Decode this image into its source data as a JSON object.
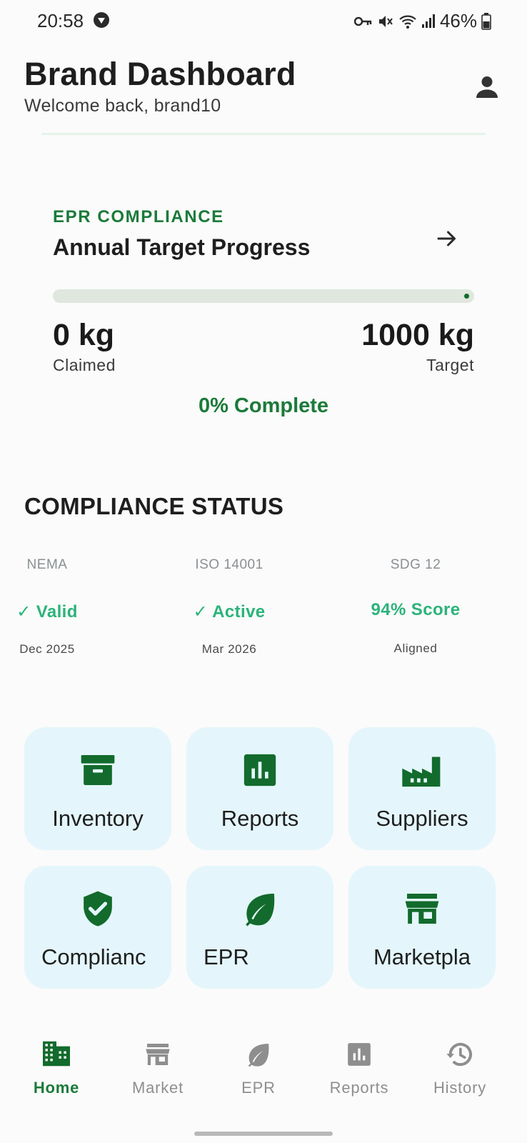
{
  "status_bar": {
    "time": "20:58",
    "battery": "46%",
    "icons": [
      "app-shield-icon",
      "vpn-key-icon",
      "mute-icon",
      "wifi-icon",
      "signal-icon",
      "battery-icon"
    ]
  },
  "header": {
    "title": "Brand Dashboard",
    "subtitle": "Welcome back, brand10",
    "profile_icon": "person-icon"
  },
  "epr_card": {
    "eyebrow": "EPR COMPLIANCE",
    "title": "Annual Target Progress",
    "progress_fraction": 0,
    "claimed_value": "0 kg",
    "claimed_label": "Claimed",
    "target_value": "1000 kg",
    "target_label": "Target",
    "complete_text": "0% Complete"
  },
  "compliance": {
    "title": "COMPLIANCE STATUS",
    "items": [
      {
        "name": "NEMA",
        "value": "✓ Valid",
        "sub": "Dec 2025"
      },
      {
        "name": "ISO 14001",
        "value": "✓ Active",
        "sub": "Mar 2026"
      },
      {
        "name": "SDG 12",
        "value": "94% Score",
        "sub": "Aligned"
      }
    ]
  },
  "tiles": [
    {
      "label": "Inventory",
      "icon": "archive-box-icon"
    },
    {
      "label": "Reports",
      "icon": "bar-chart-icon"
    },
    {
      "label": "Suppliers",
      "icon": "factory-icon"
    },
    {
      "label": "Complianc",
      "icon": "shield-check-icon"
    },
    {
      "label": "EPR",
      "icon": "leaf-icon"
    },
    {
      "label": "Marketpla",
      "icon": "storefront-icon"
    }
  ],
  "nav": [
    {
      "label": "Home",
      "icon": "building-icon",
      "active": true
    },
    {
      "label": "Market",
      "icon": "storefront-icon",
      "active": false
    },
    {
      "label": "EPR",
      "icon": "leaf-icon",
      "active": false
    },
    {
      "label": "Reports",
      "icon": "bar-chart-icon",
      "active": false
    },
    {
      "label": "History",
      "icon": "history-icon",
      "active": false
    }
  ],
  "colors": {
    "brand_green": "#1b7a3a",
    "dark_green": "#126b2c",
    "status_green": "#2bb37a",
    "tile_bg": "#e4f6fb",
    "inactive_gray": "#8e8e8e"
  }
}
